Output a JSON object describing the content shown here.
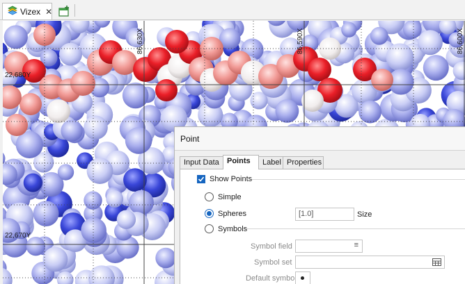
{
  "tab": {
    "label": "Vizex",
    "close_glyph": "✕"
  },
  "icons": {
    "tab_icon": "layers-icon",
    "new_tab": "new-window-icon",
    "field_icon": "list-icon",
    "picker_icon": "table-icon"
  },
  "viewport": {
    "coords": {
      "y1": "22,680Y",
      "y2": "22,670Y",
      "x1": "86,630X",
      "x2": "86,590X",
      "x3": "86,600X"
    }
  },
  "panel": {
    "title": "Point",
    "tabs": [
      {
        "label": "Input Data",
        "active": false
      },
      {
        "label": "Points",
        "active": true
      },
      {
        "label": "Label",
        "active": false
      },
      {
        "label": "Properties",
        "active": false
      }
    ],
    "show_points": {
      "label": "Show Points",
      "checked": true
    },
    "simple": {
      "label": "Simple",
      "selected": false
    },
    "spheres": {
      "label": "Spheres",
      "selected": true,
      "value": "[1.0]",
      "suffix": "Size"
    },
    "symbols": {
      "label": "Symbols",
      "selected": false
    },
    "symbol_field": {
      "label": "Symbol field",
      "value": ""
    },
    "symbol_set": {
      "label": "Symbol set",
      "value": ""
    },
    "default_symbol": {
      "label": "Default symbol"
    }
  },
  "colors": {
    "accent": "#1565c0",
    "sphere_blue": "#8e96e8",
    "sphere_deep_blue": "#2c38d6",
    "sphere_red": "#e8232d",
    "sphere_white": "#f3efef"
  }
}
